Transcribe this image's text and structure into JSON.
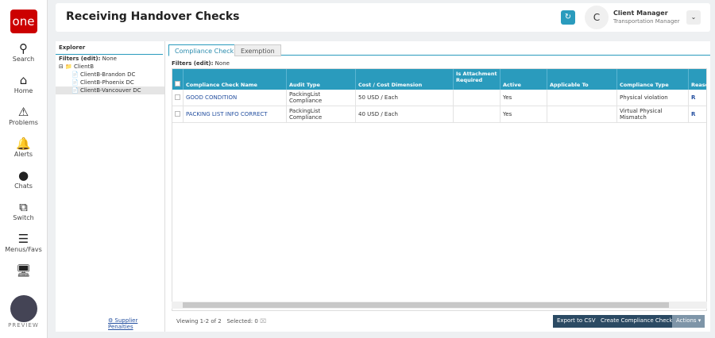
{
  "nav": {
    "logo": "one",
    "items": [
      {
        "icon": "search-icon",
        "label": "Search"
      },
      {
        "icon": "home-icon",
        "label": "Home"
      },
      {
        "icon": "warning-icon",
        "label": "Problems"
      },
      {
        "icon": "bell-icon",
        "label": "Alerts"
      },
      {
        "icon": "chat-icon",
        "label": "Chats"
      },
      {
        "icon": "switch-icon",
        "label": "Switch"
      },
      {
        "icon": "menu-icon",
        "label": "Menus/Favs"
      }
    ],
    "preview": "PREVIEW"
  },
  "header": {
    "title": "Receiving Handover Checks",
    "avatar": "C",
    "user": "Client Manager",
    "role": "Transportation Manager"
  },
  "explorer": {
    "title": "Explorer",
    "filters": "Filters (edit):",
    "filters_value": "None",
    "root": "ClientB",
    "children": [
      "ClientB-Brandon DC",
      "ClientB-Phoenix DC",
      "ClientB-Vancouver DC"
    ],
    "supplier_link": "Supplier Penalties"
  },
  "tabs": [
    "Compliance Check",
    "Exemption"
  ],
  "filters": {
    "label": "Filters (edit):",
    "value": "None"
  },
  "table": {
    "columns": [
      "Compliance Check Name",
      "Audit Type",
      "Cost / Cost Dimension",
      "Is Attachment Required",
      "Active",
      "Applicable To",
      "Compliance Type",
      "Reaso"
    ],
    "rows": [
      [
        "GOOD CONDITION",
        "PackingList Compliance",
        "50 USD / Each",
        "",
        "Yes",
        "",
        "Physical violation",
        "R"
      ],
      [
        "PACKING LIST INFO CORRECT",
        "PackingList Compliance",
        "40 USD / Each",
        "",
        "Yes",
        "",
        "Virtual Physical Mismatch",
        "R"
      ]
    ]
  },
  "footer": {
    "viewing": "Viewing 1-2 of 2",
    "selected": "Selected: 0",
    "export": "Export to CSV",
    "create": "Create Compliance Check",
    "actions": "Actions ▾"
  }
}
